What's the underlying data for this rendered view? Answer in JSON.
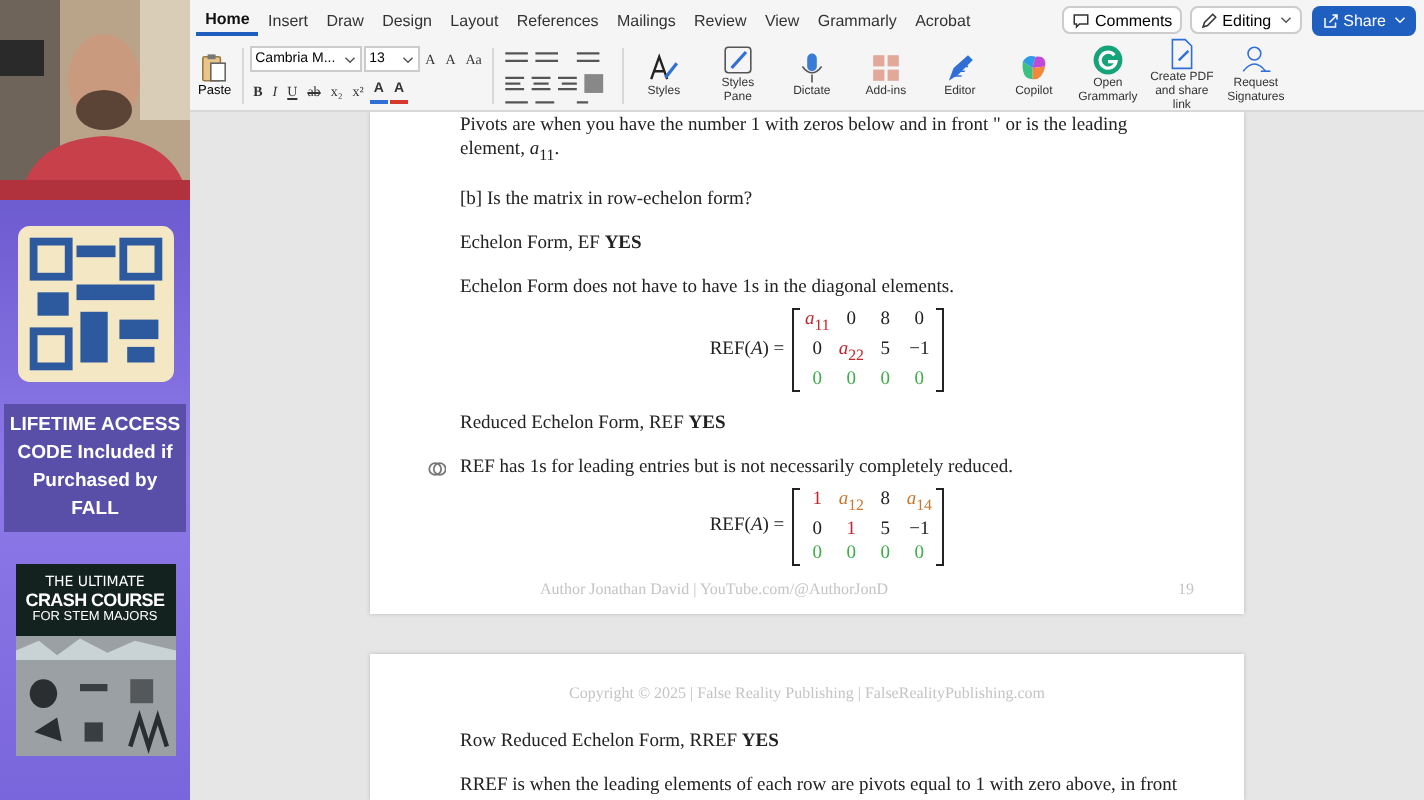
{
  "promo": {
    "text": "LIFETIME ACCESS CODE Included if Purchased by FALL",
    "book": {
      "kicker": "THE ULTIMATE",
      "title": "CRASH COURSE",
      "subtitle": "FOR STEM MAJORS"
    }
  },
  "ribbon": {
    "tabs": [
      {
        "label": "Home",
        "selected": true
      },
      {
        "label": "Insert",
        "selected": false
      },
      {
        "label": "Draw",
        "selected": false
      },
      {
        "label": "Design",
        "selected": false
      },
      {
        "label": "Layout",
        "selected": false
      },
      {
        "label": "References",
        "selected": false
      },
      {
        "label": "Mailings",
        "selected": false
      },
      {
        "label": "Review",
        "selected": false
      },
      {
        "label": "View",
        "selected": false
      },
      {
        "label": "Grammarly",
        "selected": false
      },
      {
        "label": "Acrobat",
        "selected": false
      }
    ],
    "comments": "Comments",
    "editing": "Editing",
    "share": "Share",
    "paste": "Paste",
    "font": "Cambria M...",
    "size": "13",
    "size_buttons": [
      "A",
      "A",
      "Aa"
    ],
    "format_buttons": [
      {
        "label": "B",
        "kind": "bold"
      },
      {
        "label": "I",
        "kind": "italic"
      },
      {
        "label": "U",
        "kind": "underline"
      },
      {
        "label": "ab",
        "kind": "strike"
      },
      {
        "label": "x₂",
        "kind": "plain"
      },
      {
        "label": "x²",
        "kind": "plain"
      }
    ],
    "color_buttons": [
      {
        "label": "A",
        "color": "#2f6fd6"
      },
      {
        "label": "A",
        "color": "#d8372b"
      }
    ],
    "big_buttons": [
      {
        "label": "Styles",
        "kind": "styles"
      },
      {
        "label": "Styles Pane",
        "kind": "pane"
      },
      {
        "label": "Dictate",
        "kind": "mic"
      },
      {
        "label": "Add-ins",
        "kind": "grid"
      },
      {
        "label": "Editor",
        "kind": "pen"
      },
      {
        "label": "Copilot",
        "kind": "swirl"
      },
      {
        "label": "Open Grammarly",
        "kind": "g"
      },
      {
        "label": "Create PDF and share link",
        "kind": "pdf"
      },
      {
        "label": "Request Signatures",
        "kind": "sign"
      }
    ]
  },
  "pages": [
    {
      "blocks": [
        {
          "kind": "para",
          "text": "Pivots are when you have the number 1 with zeros below and in front \" or is the leading element, *a*$_{11}$."
        },
        {
          "kind": "para",
          "text": "[b] Is the matrix in row-echelon form?"
        },
        {
          "kind": "para",
          "text": "Echelon Form, EF **YES**"
        },
        {
          "kind": "para",
          "text": "Echelon Form does not have to have 1s in the diagonal elements."
        },
        {
          "kind": "matrix",
          "label": "REF(*A*) =",
          "rows": [
            [
              {
                "text": "*a*$_{11}$",
                "color": "#c0262d"
              },
              {
                "text": "0",
                "color": "#222222"
              },
              {
                "text": "8",
                "color": "#222222"
              },
              {
                "text": "0",
                "color": "#222222"
              }
            ],
            [
              {
                "text": "0",
                "color": "#222222"
              },
              {
                "text": "*a*$_{22}$",
                "color": "#c0262d"
              },
              {
                "text": "5",
                "color": "#222222"
              },
              {
                "text": "−1",
                "color": "#222222"
              }
            ],
            [
              {
                "text": "0",
                "color": "#3fae49"
              },
              {
                "text": "0",
                "color": "#3fae49"
              },
              {
                "text": "0",
                "color": "#3fae49"
              },
              {
                "text": "0",
                "color": "#3fae49"
              }
            ]
          ]
        },
        {
          "kind": "para",
          "text": "Reduced Echelon Form, REF **YES**"
        },
        {
          "kind": "para",
          "text": "REF has 1s for leading entries but is not necessarily completely reduced.",
          "comment": true
        },
        {
          "kind": "matrix",
          "label": "REF(*A*) =",
          "rows": [
            [
              {
                "text": "1",
                "color": "#c0262d"
              },
              {
                "text": "*a*$_{12}$",
                "color": "#c7782f"
              },
              {
                "text": "8",
                "color": "#222222"
              },
              {
                "text": "*a*$_{14}$",
                "color": "#c7782f"
              }
            ],
            [
              {
                "text": "0",
                "color": "#222222"
              },
              {
                "text": "1",
                "color": "#c0262d"
              },
              {
                "text": "5",
                "color": "#222222"
              },
              {
                "text": "−1",
                "color": "#222222"
              }
            ],
            [
              {
                "text": "0",
                "color": "#3fae49"
              },
              {
                "text": "0",
                "color": "#3fae49"
              },
              {
                "text": "0",
                "color": "#3fae49"
              },
              {
                "text": "0",
                "color": "#3fae49"
              }
            ]
          ]
        }
      ],
      "footer": {
        "text": "Author Jonathan David | YouTube.com/@AuthorJonD",
        "page": "19"
      }
    },
    {
      "header": "Copyright © 2025 | False Reality Publishing | FalseRealityPublishing.com",
      "blocks": [
        {
          "kind": "para",
          "text": "Row Reduced Echelon Form, RREF **YES**"
        },
        {
          "kind": "para",
          "text": "RREF is when the leading elements of each row are pivots equal to 1 with zero above, in front"
        }
      ]
    }
  ]
}
